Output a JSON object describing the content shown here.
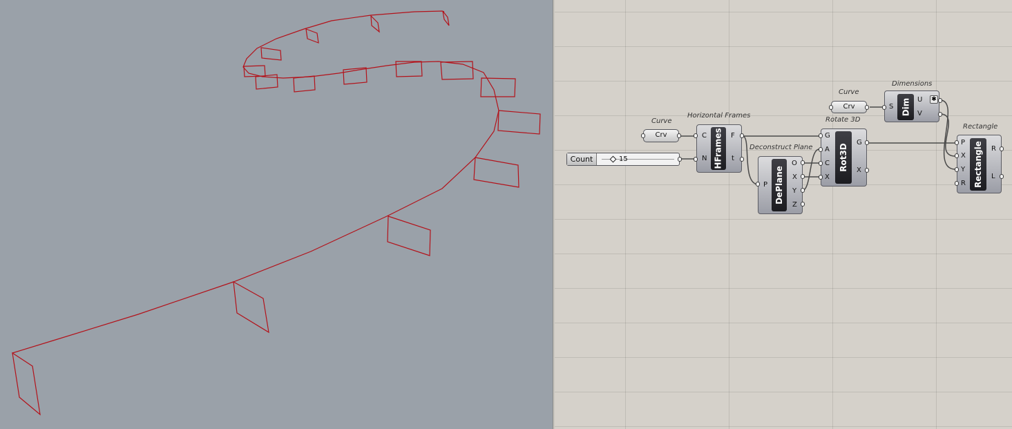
{
  "viewport": {
    "curve_color": "#b3121a",
    "background": "#9aa1a9"
  },
  "canvas": {
    "background": "#d5d1ca",
    "labels": {
      "curve1": "Curve",
      "hframes": "Horizontal Frames",
      "curve2": "Curve",
      "dimensions": "Dimensions",
      "rotate": "Rotate 3D",
      "deplane": "Deconstruct Plane",
      "rectangle": "Rectangle"
    },
    "param1": "Crv",
    "param2": "Crv",
    "slider": {
      "name": "Count",
      "value": "15"
    },
    "hframes": {
      "nick": "HFrames",
      "in": [
        "C",
        "N"
      ],
      "out": [
        "F",
        "t"
      ]
    },
    "deplane": {
      "nick": "DePlane",
      "in": [
        "P"
      ],
      "out": [
        "O",
        "X",
        "Y",
        "Z"
      ]
    },
    "rot3d": {
      "nick": "Rot3D",
      "in": [
        "G",
        "A",
        "C",
        "X"
      ],
      "out": [
        "G",
        "X"
      ]
    },
    "dim": {
      "nick": "Dim",
      "in": [
        "S"
      ],
      "out": [
        "U",
        "V"
      ]
    },
    "rectangle": {
      "nick": "Rectangle",
      "in": [
        "P",
        "X",
        "Y",
        "R"
      ],
      "out": [
        "R",
        "L"
      ]
    }
  }
}
